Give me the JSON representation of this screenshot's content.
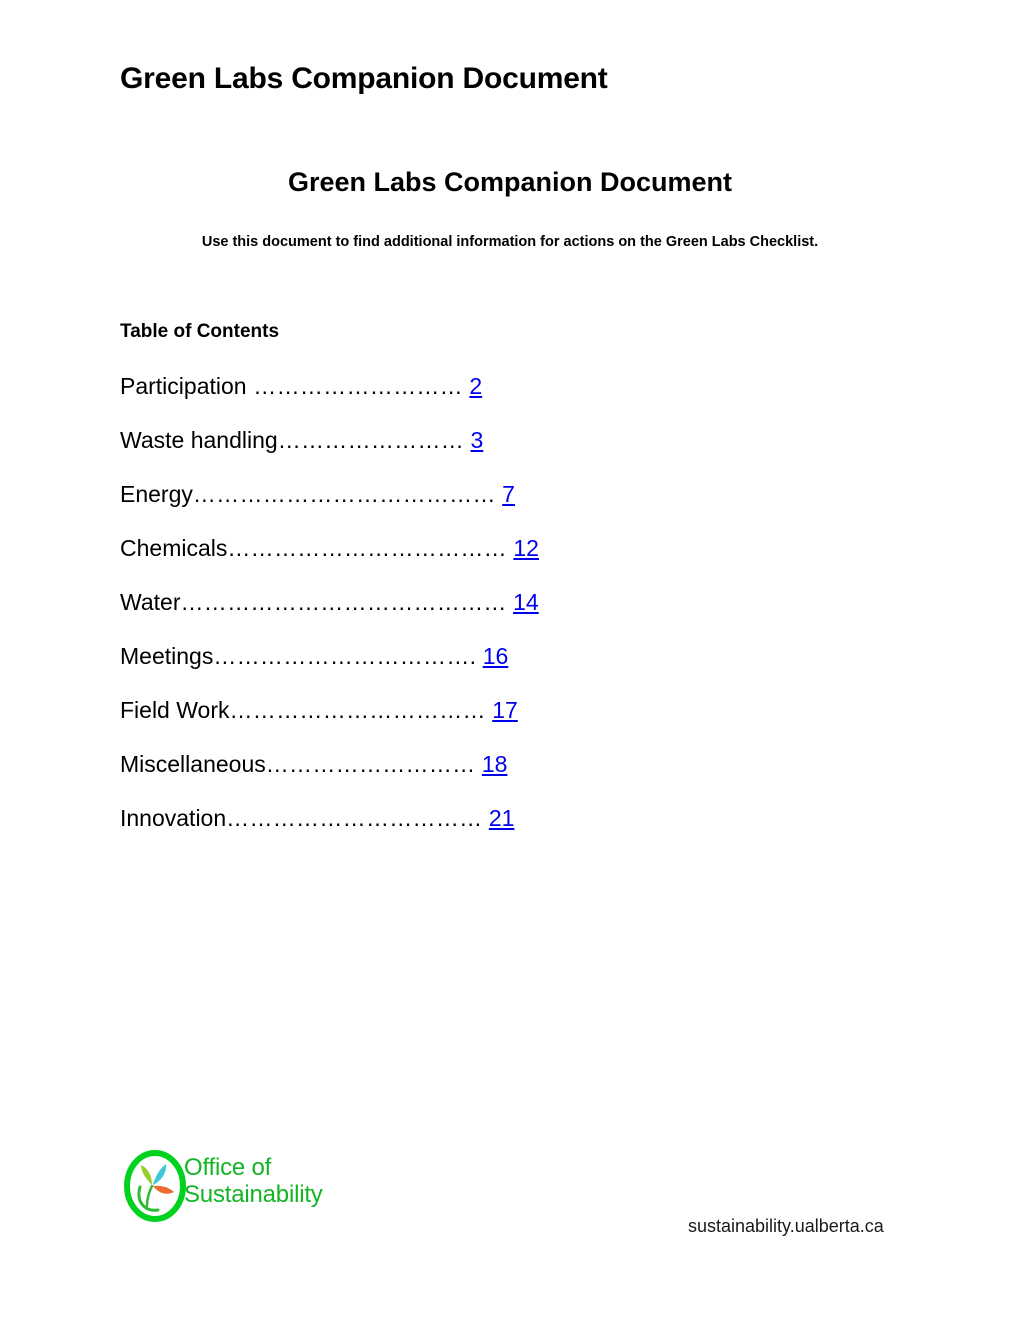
{
  "document": {
    "heading": "Green Labs Companion Document",
    "title": "Green Labs Companion Document",
    "subtitle": "Use this document to find additional information for actions on the Green Labs Checklist."
  },
  "toc": {
    "heading": "Table of Contents",
    "entries": [
      {
        "label": "Participation",
        "leader": " ………………………",
        "page": "2"
      },
      {
        "label": "Waste handling",
        "leader": "……………………",
        "page": "3"
      },
      {
        "label": "Energy",
        "leader": "…………………………………",
        "page": "7"
      },
      {
        "label": "Chemicals",
        "leader": "………………………………",
        "page": "12"
      },
      {
        "label": "Water",
        "leader": "……………………………………",
        "page": "14"
      },
      {
        "label": "Meetings",
        "leader": "…………………………….",
        "page": "16"
      },
      {
        "label": "Field Work",
        "leader": "……………………………",
        "page": "17"
      },
      {
        "label": "Miscellaneous",
        "leader": "………………………",
        "page": "18"
      },
      {
        "label": "Innovation",
        "leader": "……………………………",
        "page": "21"
      }
    ]
  },
  "footer": {
    "logo": {
      "line1": "Office of",
      "line2": "Sustainability",
      "mark_name": "office-of-sustainability-logo"
    },
    "url": "sustainability.ualberta.ca"
  },
  "colors": {
    "link_blue": "#0000EE",
    "logo_green": "#13b524",
    "ring_green": "#00d21e",
    "leaf_yellow_green": "#9acd32",
    "leaf_cyan": "#3fc8d8",
    "leaf_orange": "#ef6b33",
    "text_black": "#000000"
  }
}
